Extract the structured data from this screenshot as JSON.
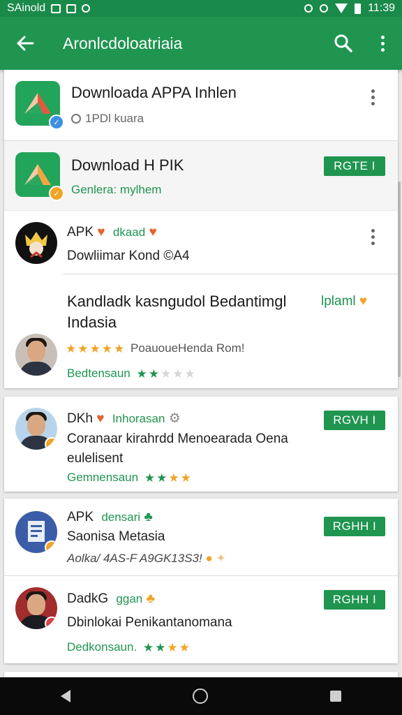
{
  "status_bar": {
    "carrier": "SAinold",
    "time": "11:39"
  },
  "app_bar": {
    "title": "Aronlcdoloatriaia"
  },
  "colors": {
    "primary": "#1f9550",
    "primary_dark": "#1a8a4a",
    "star_orange": "#f0a428"
  },
  "items": [
    {
      "title": "Downloada APPA Inhlen",
      "subtitle": "1PDl kuara",
      "icon": "logo-icon"
    },
    {
      "title": "Download H PIK",
      "subtitle": "Genlera: mylhem",
      "button": "RGTE I",
      "icon": "logo-icon"
    },
    {
      "title": "APK",
      "tag": "dkaad",
      "subtitle": "Dowliimar Kond ©A4"
    },
    {
      "title": "Kandladk kasngudol Bedantimgl",
      "title2": "Indasia",
      "tag": "lplaml",
      "review": "PoauoueHenda Rom!",
      "rating_label": "Bedtensaun",
      "rating": 2
    },
    {
      "title": "DKh",
      "tag": "Inhorasan",
      "subtitle": "Coranaar kirahrdd Menoearada Oena",
      "subtitle2": "eulelisent",
      "rating_label": "Gemnensaun",
      "rating": 4,
      "button": "RGVH I"
    },
    {
      "title": "APK",
      "tag": "densari",
      "subtitle": "Saonisa Metasia",
      "meta": "Aolka/ 4AS-F A9GK13S3!",
      "button": "RGHH I"
    },
    {
      "title": "DadkG",
      "tag": "ggan",
      "subtitle": "Dbinlokai Penikantanomana",
      "rating_label": "Dedkonsaun.",
      "rating": 4,
      "button": "RGHH I"
    }
  ]
}
